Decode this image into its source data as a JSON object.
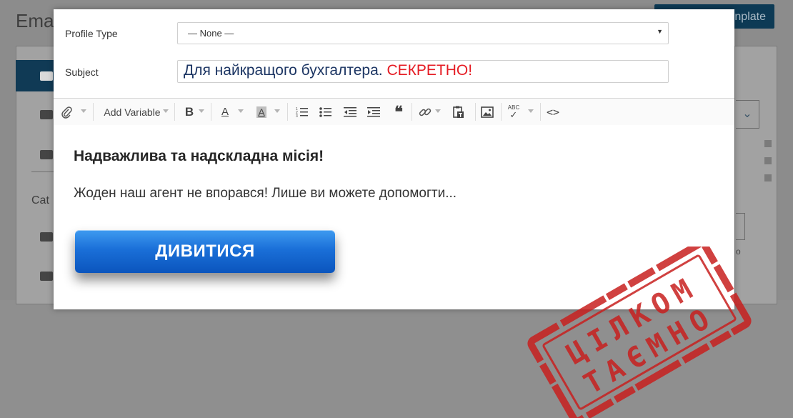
{
  "background": {
    "title": "Ema",
    "button_label": "nplate",
    "category_label": "Cat",
    "small_text": "o"
  },
  "modal": {
    "profile_type": {
      "label": "Profile Type",
      "value": "— None —"
    },
    "subject": {
      "label": "Subject",
      "text_main": "Для найкращого бухгалтера.",
      "text_secret": "СЕКРЕТНО!"
    },
    "toolbar": {
      "items": [
        {
          "name": "attachment-icon"
        },
        {
          "label": "Add Variable"
        },
        {
          "name": "bold-icon",
          "label": "B"
        },
        {
          "name": "font-color-icon",
          "label": "A"
        },
        {
          "name": "background-color-icon",
          "label": "A"
        },
        {
          "name": "ordered-list-icon"
        },
        {
          "name": "unordered-list-icon"
        },
        {
          "name": "outdent-icon"
        },
        {
          "name": "indent-icon"
        },
        {
          "name": "blockquote-icon"
        },
        {
          "name": "link-icon"
        },
        {
          "name": "paste-text-icon"
        },
        {
          "name": "image-icon"
        },
        {
          "name": "spellcheck-icon",
          "label": "ABC"
        },
        {
          "name": "source-code-icon",
          "label": "<>"
        }
      ]
    },
    "content": {
      "heading": "Надважлива та надскладна місія!",
      "paragraph": "Жоден наш агент не впорався! Лише ви можете допомогти...",
      "button_label": "ДИВИТИСЯ",
      "stamp_line1": "ЦІЛКОМ",
      "stamp_line2": "ТАЄМНО",
      "stamp_color": "#c8201f"
    }
  }
}
